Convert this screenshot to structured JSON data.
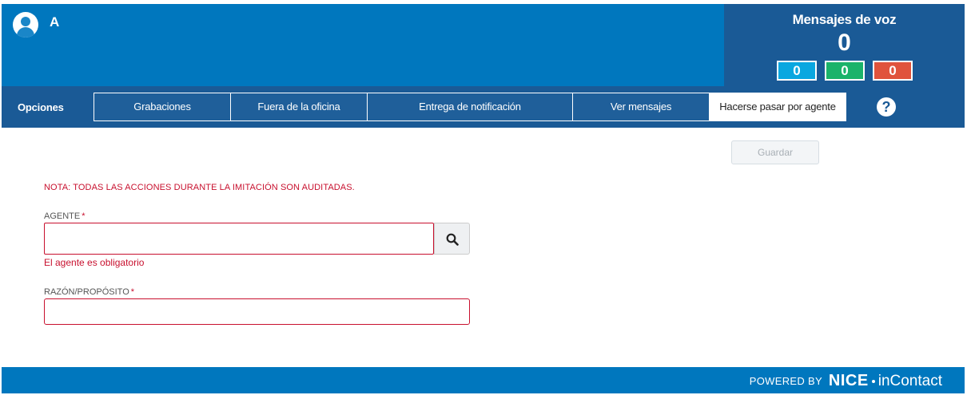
{
  "header": {
    "agent_name": "A",
    "voicemail": {
      "title": "Mensajes de voz",
      "total": "0",
      "counts": [
        "0",
        "0",
        "0"
      ],
      "colors": [
        "#0aa7e0",
        "#1bb36a",
        "#e0533c"
      ]
    }
  },
  "nav": {
    "label": "Opciones",
    "tabs": [
      {
        "label": "Grabaciones"
      },
      {
        "label": "Fuera de la oficina"
      },
      {
        "label": "Entrega de notificación"
      },
      {
        "label": "Ver mensajes"
      },
      {
        "label": "Hacerse pasar por agente",
        "active": true
      }
    ],
    "help_icon": "?"
  },
  "form": {
    "save_label": "Guardar",
    "note": "NOTA: TODAS LAS ACCIONES DURANTE LA IMITACIÓN SON AUDITADAS.",
    "agent_label": "AGENTE",
    "agent_value": "",
    "agent_error": "El agente es obligatorio",
    "reason_label": "RAZÓN/PROPÓSITO",
    "reason_value": "",
    "required_marker": "*"
  },
  "footer": {
    "powered_by": "POWERED BY",
    "brand_nice": "NICE",
    "brand_incontact": "inContact"
  },
  "colors": {
    "header_blue": "#0077be",
    "nav_dark_blue": "#1a5a96",
    "error_red": "#c8102e"
  }
}
